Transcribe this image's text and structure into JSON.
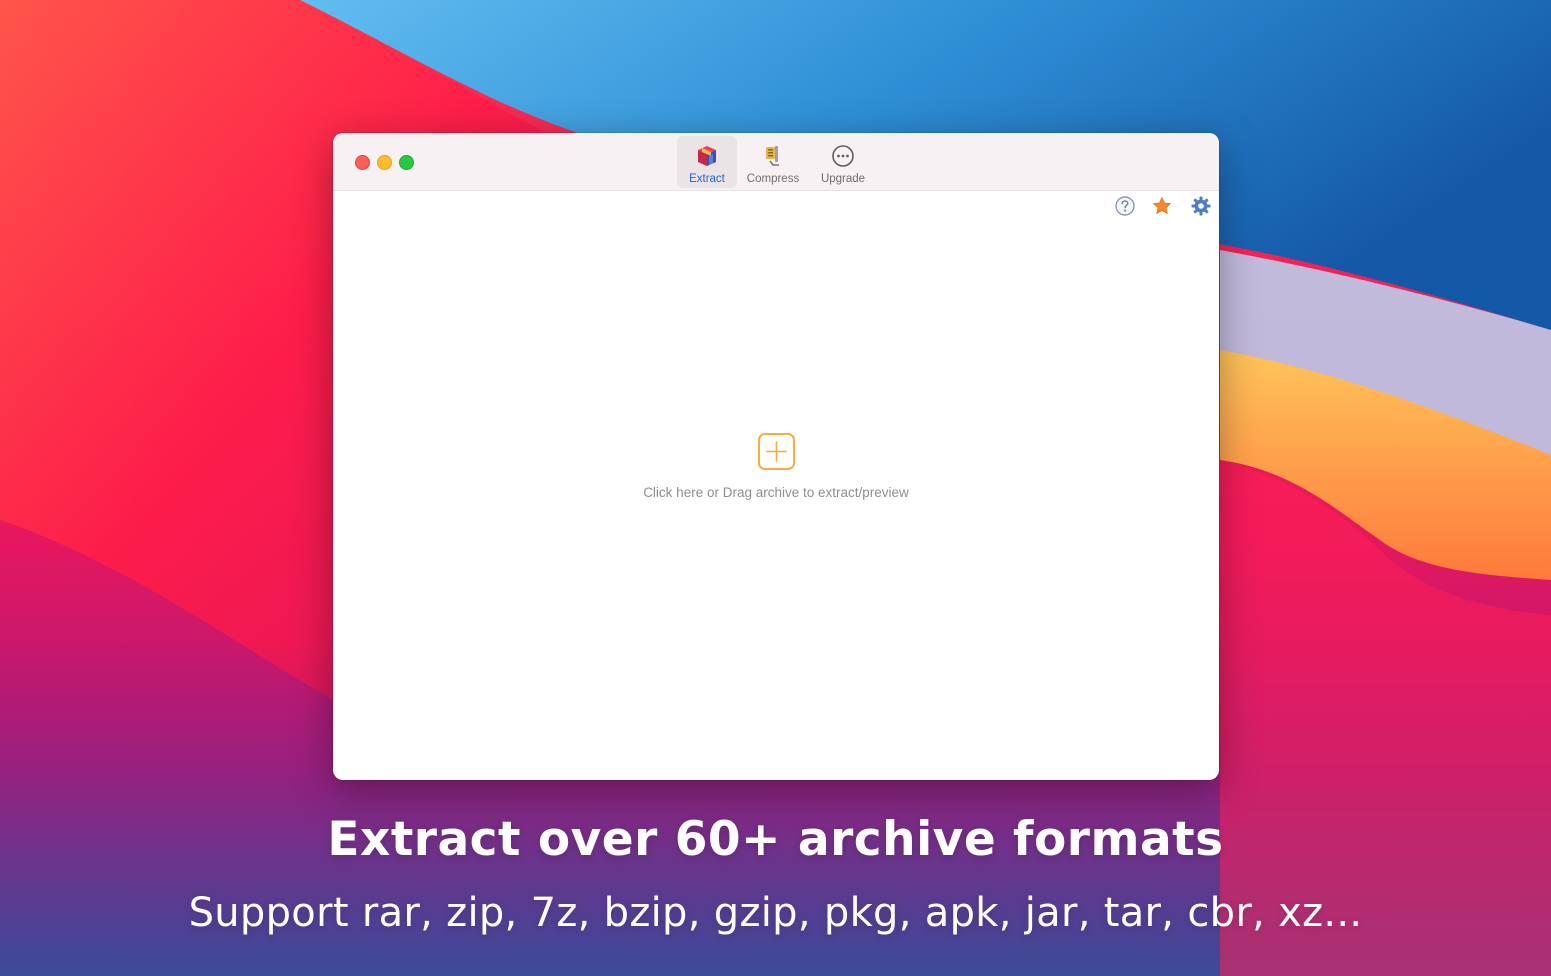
{
  "wallpaper": {
    "name": "macOS Big Sur",
    "colors": {
      "blue_dark": "#1f65b4",
      "blue_light": "#4ba6e0",
      "red": "#ff1d48",
      "orange": "#ffb04a",
      "magenta": "#c2187b",
      "purple": "#5a3d8f"
    }
  },
  "window": {
    "traffic_lights": [
      "close",
      "minimize",
      "zoom"
    ],
    "toolbar": [
      {
        "label": "Extract",
        "icon": "extract-icon",
        "active": true
      },
      {
        "label": "Compress",
        "icon": "compress-icon",
        "active": false
      },
      {
        "label": "Upgrade",
        "icon": "more-circle-icon",
        "active": false
      }
    ],
    "actions": [
      {
        "name": "help",
        "icon": "help-icon"
      },
      {
        "name": "favorite",
        "icon": "star-icon"
      },
      {
        "name": "settings",
        "icon": "gear-icon"
      }
    ],
    "drop_zone": {
      "icon": "plus-icon",
      "text": "Click here or Drag archive to extract/preview"
    },
    "colors": {
      "accent": "#2a62c9",
      "plus": "#f3ae45",
      "star": "#f5882a",
      "gear": "#4e7fc0"
    }
  },
  "marketing": {
    "headline": "Extract over 60+ archive formats",
    "subheadline": "Support rar, zip, 7z, bzip, gzip, pkg, apk, jar, tar, cbr, xz..."
  }
}
